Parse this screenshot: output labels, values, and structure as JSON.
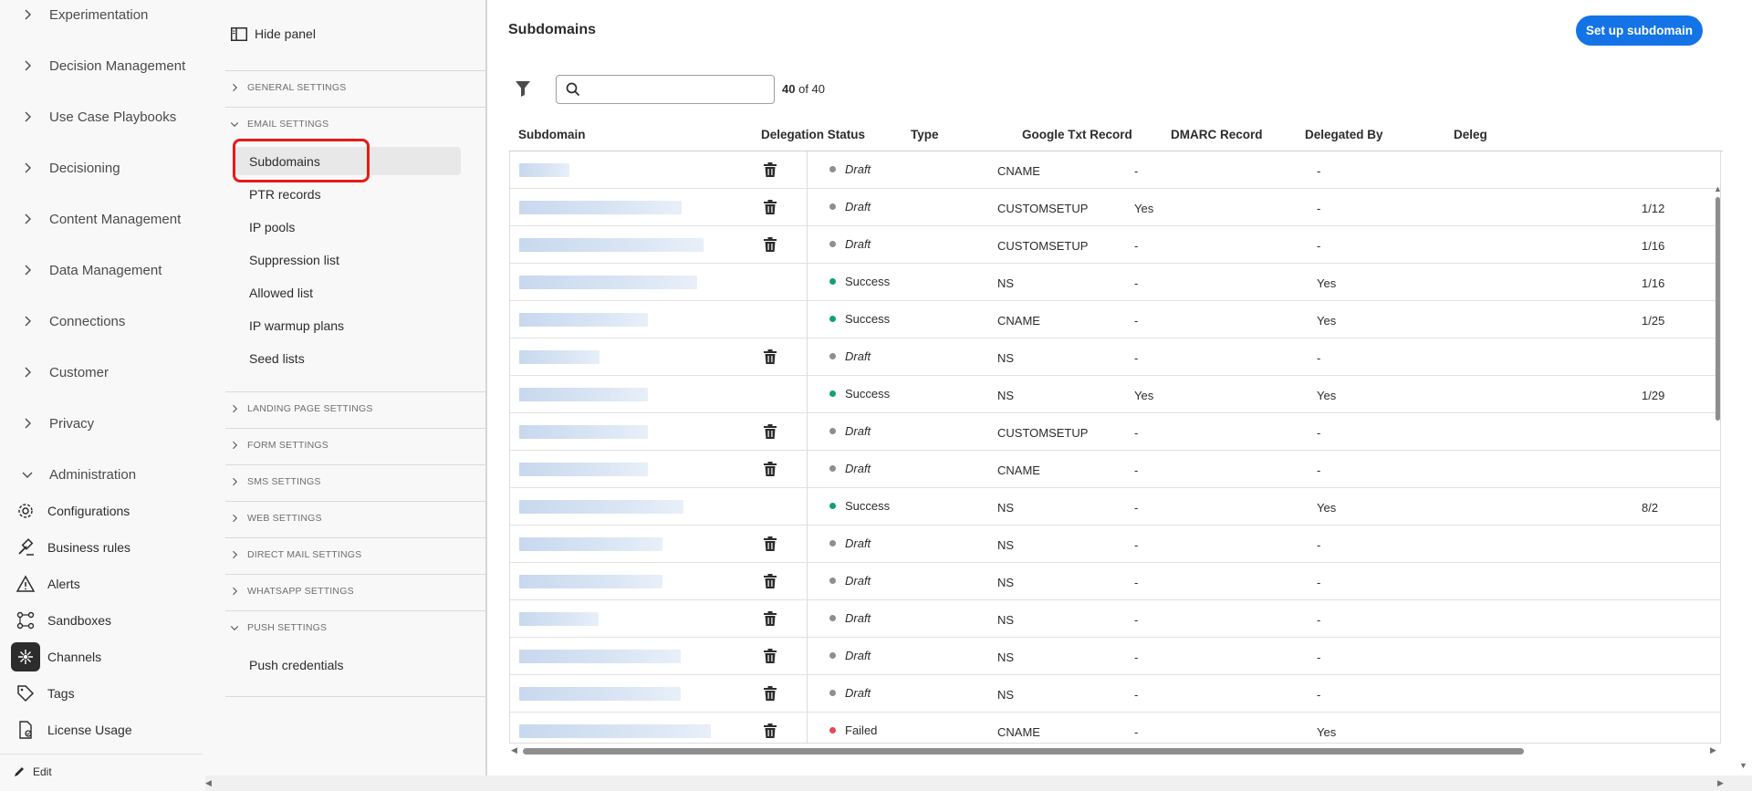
{
  "left_nav": {
    "items": [
      {
        "label": "Experimentation",
        "expanded": false
      },
      {
        "label": "Decision Management",
        "expanded": false
      },
      {
        "label": "Use Case Playbooks",
        "expanded": false
      },
      {
        "label": "Decisioning",
        "expanded": false
      },
      {
        "label": "Content Management",
        "expanded": false
      },
      {
        "label": "Data Management",
        "expanded": false
      },
      {
        "label": "Connections",
        "expanded": false
      },
      {
        "label": "Customer",
        "expanded": false
      },
      {
        "label": "Privacy",
        "expanded": false
      },
      {
        "label": "Administration",
        "expanded": true
      }
    ],
    "admin_items": [
      {
        "label": "Configurations",
        "icon": "gear-icon"
      },
      {
        "label": "Business rules",
        "icon": "gavel-icon"
      },
      {
        "label": "Alerts",
        "icon": "alert-icon"
      },
      {
        "label": "Sandboxes",
        "icon": "sandbox-icon"
      },
      {
        "label": "Channels",
        "icon": "channels-icon",
        "active": true
      },
      {
        "label": "Tags",
        "icon": "tag-icon"
      },
      {
        "label": "License Usage",
        "icon": "license-icon"
      }
    ],
    "edit_label": "Edit"
  },
  "panel": {
    "hide_panel_label": "Hide panel",
    "sections": [
      {
        "label": "GENERAL SETTINGS",
        "expanded": false
      },
      {
        "label": "EMAIL SETTINGS",
        "expanded": true
      },
      {
        "label": "LANDING PAGE SETTINGS",
        "expanded": false
      },
      {
        "label": "FORM SETTINGS",
        "expanded": false
      },
      {
        "label": "SMS SETTINGS",
        "expanded": false
      },
      {
        "label": "WEB SETTINGS",
        "expanded": false
      },
      {
        "label": "DIRECT MAIL SETTINGS",
        "expanded": false
      },
      {
        "label": "WHATSAPP SETTINGS",
        "expanded": false
      },
      {
        "label": "PUSH SETTINGS",
        "expanded": true
      }
    ],
    "email_items": [
      "Subdomains",
      "PTR records",
      "IP pools",
      "Suppression list",
      "Allowed list",
      "IP warmup plans",
      "Seed lists"
    ],
    "push_items": [
      "Push credentials"
    ],
    "selected": "Subdomains"
  },
  "main": {
    "title": "Subdomains",
    "setup_button": "Set up subdomain",
    "search_placeholder": "",
    "count_shown": "40",
    "count_total": "of 40",
    "columns": [
      "Subdomain",
      "Delegation Status",
      "Type",
      "Google Txt Record",
      "DMARC Record",
      "Delegated By",
      "Deleg"
    ],
    "rows": [
      {
        "deletable": true,
        "status": "Draft",
        "type": "CNAME",
        "google_txt": "-",
        "dmarc": "-",
        "date": ""
      },
      {
        "deletable": true,
        "status": "Draft",
        "type": "CUSTOMSETUP",
        "google_txt": "Yes",
        "dmarc": "-",
        "date": "1/12"
      },
      {
        "deletable": true,
        "status": "Draft",
        "type": "CUSTOMSETUP",
        "google_txt": "-",
        "dmarc": "-",
        "date": "1/16"
      },
      {
        "deletable": false,
        "status": "Success",
        "type": "NS",
        "google_txt": "-",
        "dmarc": "Yes",
        "date": "1/16"
      },
      {
        "deletable": false,
        "status": "Success",
        "type": "CNAME",
        "google_txt": "-",
        "dmarc": "Yes",
        "date": "1/25"
      },
      {
        "deletable": true,
        "status": "Draft",
        "type": "NS",
        "google_txt": "-",
        "dmarc": "-",
        "date": ""
      },
      {
        "deletable": false,
        "status": "Success",
        "type": "NS",
        "google_txt": "Yes",
        "dmarc": "Yes",
        "date": "1/29"
      },
      {
        "deletable": true,
        "status": "Draft",
        "type": "CUSTOMSETUP",
        "google_txt": "-",
        "dmarc": "-",
        "date": ""
      },
      {
        "deletable": true,
        "status": "Draft",
        "type": "CNAME",
        "google_txt": "-",
        "dmarc": "-",
        "date": ""
      },
      {
        "deletable": false,
        "status": "Success",
        "type": "NS",
        "google_txt": "-",
        "dmarc": "Yes",
        "date": "8/2"
      },
      {
        "deletable": true,
        "status": "Draft",
        "type": "NS",
        "google_txt": "-",
        "dmarc": "-",
        "date": ""
      },
      {
        "deletable": true,
        "status": "Draft",
        "type": "NS",
        "google_txt": "-",
        "dmarc": "-",
        "date": ""
      },
      {
        "deletable": true,
        "status": "Draft",
        "type": "NS",
        "google_txt": "-",
        "dmarc": "-",
        "date": ""
      },
      {
        "deletable": true,
        "status": "Draft",
        "type": "NS",
        "google_txt": "-",
        "dmarc": "-",
        "date": ""
      },
      {
        "deletable": true,
        "status": "Draft",
        "type": "NS",
        "google_txt": "-",
        "dmarc": "-",
        "date": ""
      },
      {
        "deletable": true,
        "status": "Failed",
        "type": "CNAME",
        "google_txt": "-",
        "dmarc": "Yes",
        "date": ""
      }
    ]
  },
  "colors": {
    "accent": "#1473e6",
    "success": "#12a26b",
    "draft": "#8e8e8e",
    "failed": "#e34850",
    "highlight_box": "#e61a1a"
  }
}
